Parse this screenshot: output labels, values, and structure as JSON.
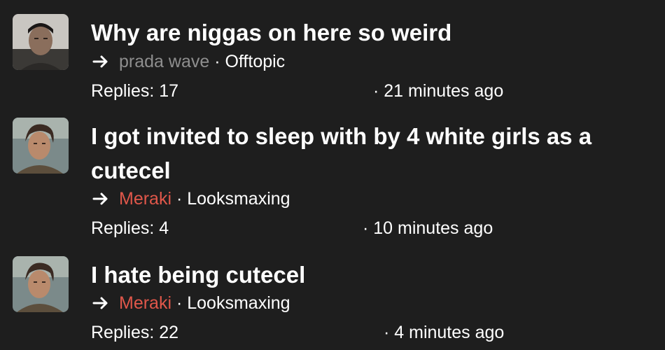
{
  "threads": [
    {
      "title": "Why are niggas on here so weird",
      "author": "prada wave",
      "separator": "·",
      "forum": "Offtopic",
      "replies": "Replies: 17",
      "time": "· 21 minutes ago",
      "avatar_icon": "user-avatar-photo"
    },
    {
      "title": "I got invited to sleep with by 4 white girls as a cutecel",
      "author": "Meraki",
      "separator": "·",
      "forum": "Looksmaxing",
      "replies": "Replies: 4",
      "time": "· 10 minutes ago",
      "avatar_icon": "user-avatar-photo"
    },
    {
      "title": "I hate being cutecel",
      "author": "Meraki",
      "separator": "·",
      "forum": "Looksmaxing",
      "replies": "Replies: 22",
      "time": "· 4 minutes ago",
      "avatar_icon": "user-avatar-photo"
    }
  ],
  "colors": {
    "background": "#1e1e1e",
    "text": "#ffffff",
    "author_muted": "#8e8e8e",
    "author_highlight": "#e0574a"
  }
}
